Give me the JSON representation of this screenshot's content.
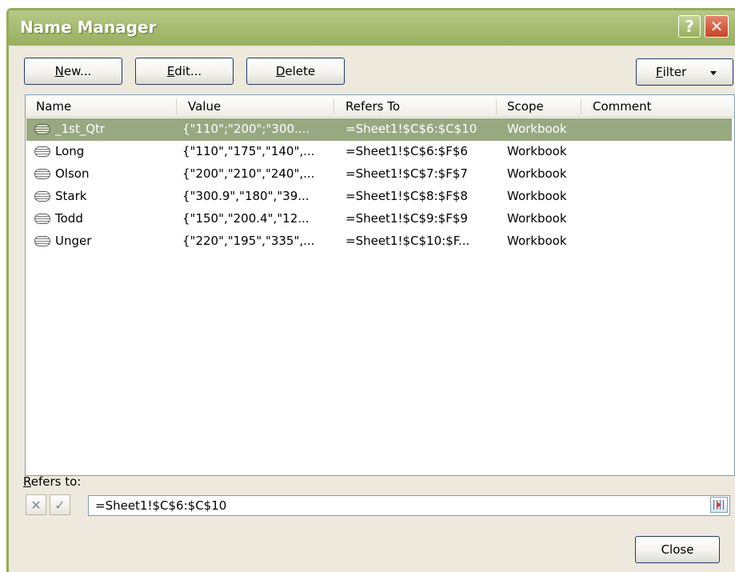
{
  "window": {
    "title": "Name Manager"
  },
  "titlebar_buttons": {
    "help": "?",
    "close": "✕"
  },
  "toolbar": {
    "new_label_u": "N",
    "new_label_rest": "ew...",
    "edit_label_u": "E",
    "edit_label_rest": "dit...",
    "delete_label_u": "D",
    "delete_label_rest": "elete",
    "filter_label_u": "F",
    "filter_label_rest": "ilter"
  },
  "list": {
    "columns": [
      "Name",
      "Value",
      "Refers To",
      "Scope",
      "Comment"
    ],
    "rows": [
      {
        "name": "_1st_Qtr",
        "value": "{\"110\";\"200\";\"300....",
        "refers_to": "=Sheet1!$C$6:$C$10",
        "scope": "Workbook",
        "comment": "",
        "selected": true
      },
      {
        "name": "Long",
        "value": "{\"110\",\"175\",\"140\",...",
        "refers_to": "=Sheet1!$C$6:$F$6",
        "scope": "Workbook",
        "comment": "",
        "selected": false
      },
      {
        "name": "Olson",
        "value": "{\"200\",\"210\",\"240\",...",
        "refers_to": "=Sheet1!$C$7:$F$7",
        "scope": "Workbook",
        "comment": "",
        "selected": false
      },
      {
        "name": "Stark",
        "value": "{\"300.9\",\"180\",\"39...",
        "refers_to": "=Sheet1!$C$8:$F$8",
        "scope": "Workbook",
        "comment": "",
        "selected": false
      },
      {
        "name": "Todd",
        "value": "{\"150\",\"200.4\",\"12...",
        "refers_to": "=Sheet1!$C$9:$F$9",
        "scope": "Workbook",
        "comment": "",
        "selected": false
      },
      {
        "name": "Unger",
        "value": "{\"220\",\"195\",\"335\",...",
        "refers_to": "=Sheet1!$C$10:$F...",
        "scope": "Workbook",
        "comment": "",
        "selected": false
      }
    ]
  },
  "refers_to": {
    "label_u": "R",
    "label_rest": "efers to:",
    "value": "=Sheet1!$C$6:$C$10",
    "cancel_glyph": "✕",
    "ok_glyph": "✓"
  },
  "footer": {
    "close_label": "Close"
  },
  "colors": {
    "titlebar": "#a7bd72",
    "selection": "#97a981",
    "dialog_bg": "#ede9dc"
  }
}
